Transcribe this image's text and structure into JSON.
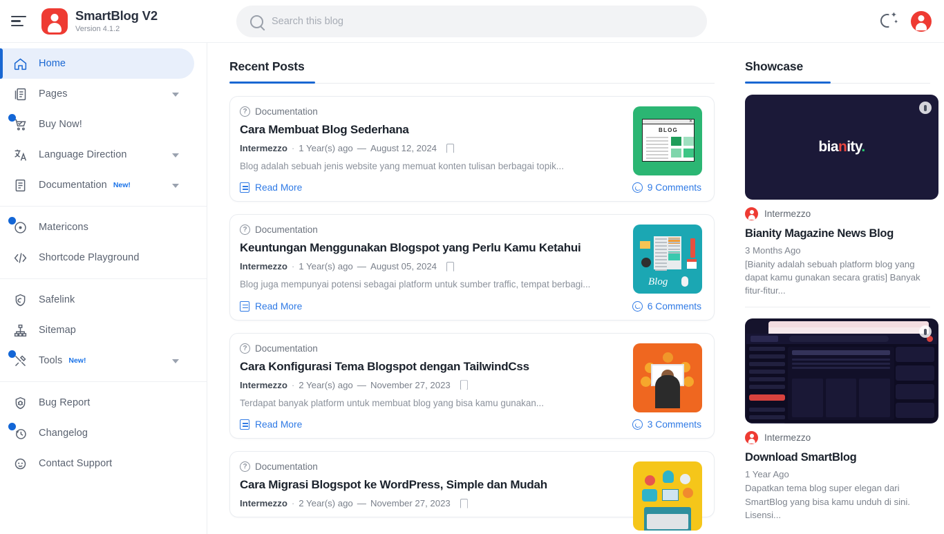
{
  "header": {
    "menu_icon": "hamburger-icon",
    "brand_title": "SmartBlog V2",
    "brand_version": "Version 4.1.2",
    "search_placeholder": "Search this blog",
    "search_value": "",
    "dark_mode_icon": "moon-icon",
    "account_icon": "account-avatar-icon",
    "brand_color": "#ee3b33",
    "accent_color": "#1967d2"
  },
  "sidebar": {
    "groups": [
      {
        "items": [
          {
            "label": "Home",
            "icon": "home-icon",
            "active": true,
            "caret": false,
            "badge": "",
            "dot": false
          },
          {
            "label": "Pages",
            "icon": "pages-icon",
            "active": false,
            "caret": true,
            "badge": "",
            "dot": false
          },
          {
            "label": "Buy Now!",
            "icon": "cart-icon",
            "active": false,
            "caret": false,
            "badge": "",
            "dot": true
          },
          {
            "label": "Language Direction",
            "icon": "translate-icon",
            "active": false,
            "caret": true,
            "badge": "",
            "dot": false
          },
          {
            "label": "Documentation",
            "icon": "document-icon",
            "active": false,
            "caret": true,
            "badge": "New!",
            "dot": false
          }
        ]
      },
      {
        "items": [
          {
            "label": "Matericons",
            "icon": "material-icon",
            "active": false,
            "caret": false,
            "badge": "",
            "dot": true
          },
          {
            "label": "Shortcode Playground",
            "icon": "code-icon",
            "active": false,
            "caret": false,
            "badge": "",
            "dot": false
          }
        ]
      },
      {
        "items": [
          {
            "label": "Safelink",
            "icon": "shield-link-icon",
            "active": false,
            "caret": false,
            "badge": "",
            "dot": false
          },
          {
            "label": "Sitemap",
            "icon": "sitemap-icon",
            "active": false,
            "caret": false,
            "badge": "",
            "dot": false
          },
          {
            "label": "Tools",
            "icon": "tools-icon",
            "active": false,
            "caret": true,
            "badge": "New!",
            "dot": true
          }
        ]
      },
      {
        "items": [
          {
            "label": "Bug Report",
            "icon": "bug-shield-icon",
            "active": false,
            "caret": false,
            "badge": "",
            "dot": false
          },
          {
            "label": "Changelog",
            "icon": "history-icon",
            "active": false,
            "caret": false,
            "badge": "",
            "dot": true
          },
          {
            "label": "Contact Support",
            "icon": "support-face-icon",
            "active": false,
            "caret": false,
            "badge": "",
            "dot": false
          }
        ]
      }
    ]
  },
  "main": {
    "section_title": "Recent Posts",
    "posts": [
      {
        "category": "Documentation",
        "title": "Cara Membuat Blog Sederhana",
        "author": "Intermezzo",
        "age": "1 Year(s) ago",
        "date": "August 12, 2024",
        "excerpt": "Blog adalah sebuah jenis website yang memuat konten tulisan berbagai topik...",
        "read_more": "Read More",
        "comments": "9 Comments",
        "thumb": "blog-window-green"
      },
      {
        "category": "Documentation",
        "title": "Keuntungan Menggunakan Blogspot yang Perlu Kamu Ketahui",
        "author": "Intermezzo",
        "age": "1 Year(s) ago",
        "date": "August 05, 2024",
        "excerpt": "Blog juga mempunyai potensi sebagai platform untuk sumber traffic, tempat berbagi...",
        "read_more": "Read More",
        "comments": "6 Comments",
        "thumb": "blog-desk-teal"
      },
      {
        "category": "Documentation",
        "title": "Cara Konfigurasi Tema Blogspot dengan TailwindCss",
        "author": "Intermezzo",
        "age": "2 Year(s) ago",
        "date": "November 27, 2023",
        "excerpt": "Terdapat banyak platform untuk membuat blog yang bisa kamu gunakan...",
        "read_more": "Read More",
        "comments": "3 Comments",
        "thumb": "person-monitor-orange"
      },
      {
        "category": "Documentation",
        "title": "Cara Migrasi Blogspot ke WordPress, Simple dan Mudah",
        "author": "Intermezzo",
        "age": "2 Year(s) ago",
        "date": "November 27, 2023",
        "excerpt": "",
        "read_more": "",
        "comments": "",
        "thumb": "laptop-ideas-yellow"
      }
    ]
  },
  "showcase": {
    "section_title": "Showcase",
    "items": [
      {
        "cover_type": "bianity-logo",
        "logo_text_1": "bia",
        "logo_text_2": "n",
        "logo_text_3": "ity",
        "logo_text_4": ".",
        "author": "Intermezzo",
        "title": "Bianity Magazine News Blog",
        "date": "3 Months Ago",
        "description": "[Bianity adalah sebuah platform blog yang dapat kamu gunakan secara gratis] Banyak fitur-fitur..."
      },
      {
        "cover_type": "browser-mock",
        "author": "Intermezzo",
        "title": "Download SmartBlog",
        "date": "1 Year Ago",
        "description": "Dapatkan tema blog super elegan dari SmartBlog yang bisa kamu unduh di sini. Lisensi..."
      }
    ]
  }
}
